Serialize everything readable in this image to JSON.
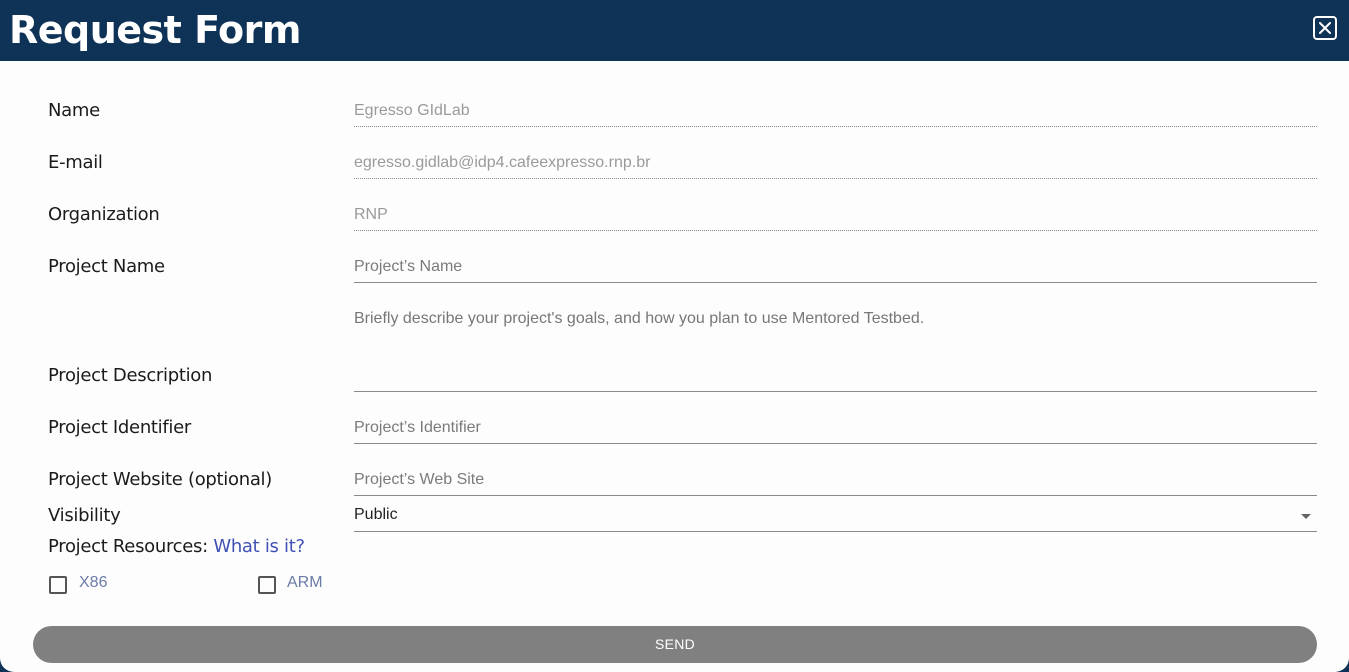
{
  "header": {
    "title": "Request Form"
  },
  "form": {
    "name": {
      "label": "Name",
      "value": "Egresso GIdLab"
    },
    "email": {
      "label": "E-mail",
      "value": "egresso.gidlab@idp4.cafeexpresso.rnp.br"
    },
    "organization": {
      "label": "Organization",
      "value": "RNP"
    },
    "project_name": {
      "label": "Project Name",
      "placeholder": "Project’s Name"
    },
    "project_description": {
      "label": "Project Description",
      "hint": "Briefly describe your project's goals, and how you plan to use Mentored Testbed."
    },
    "project_identifier": {
      "label": "Project Identifier",
      "placeholder": "Project’s Identifier"
    },
    "project_website": {
      "label": "Project Website (optional)",
      "placeholder": "Project’s Web Site"
    },
    "visibility": {
      "label": "Visibility",
      "value": "Public"
    },
    "resources": {
      "label": "Project Resources:",
      "help_link": "What is it?",
      "options": [
        {
          "label": "X86",
          "checked": false
        },
        {
          "label": "ARM",
          "checked": false
        }
      ]
    },
    "send_label": "SEND"
  }
}
